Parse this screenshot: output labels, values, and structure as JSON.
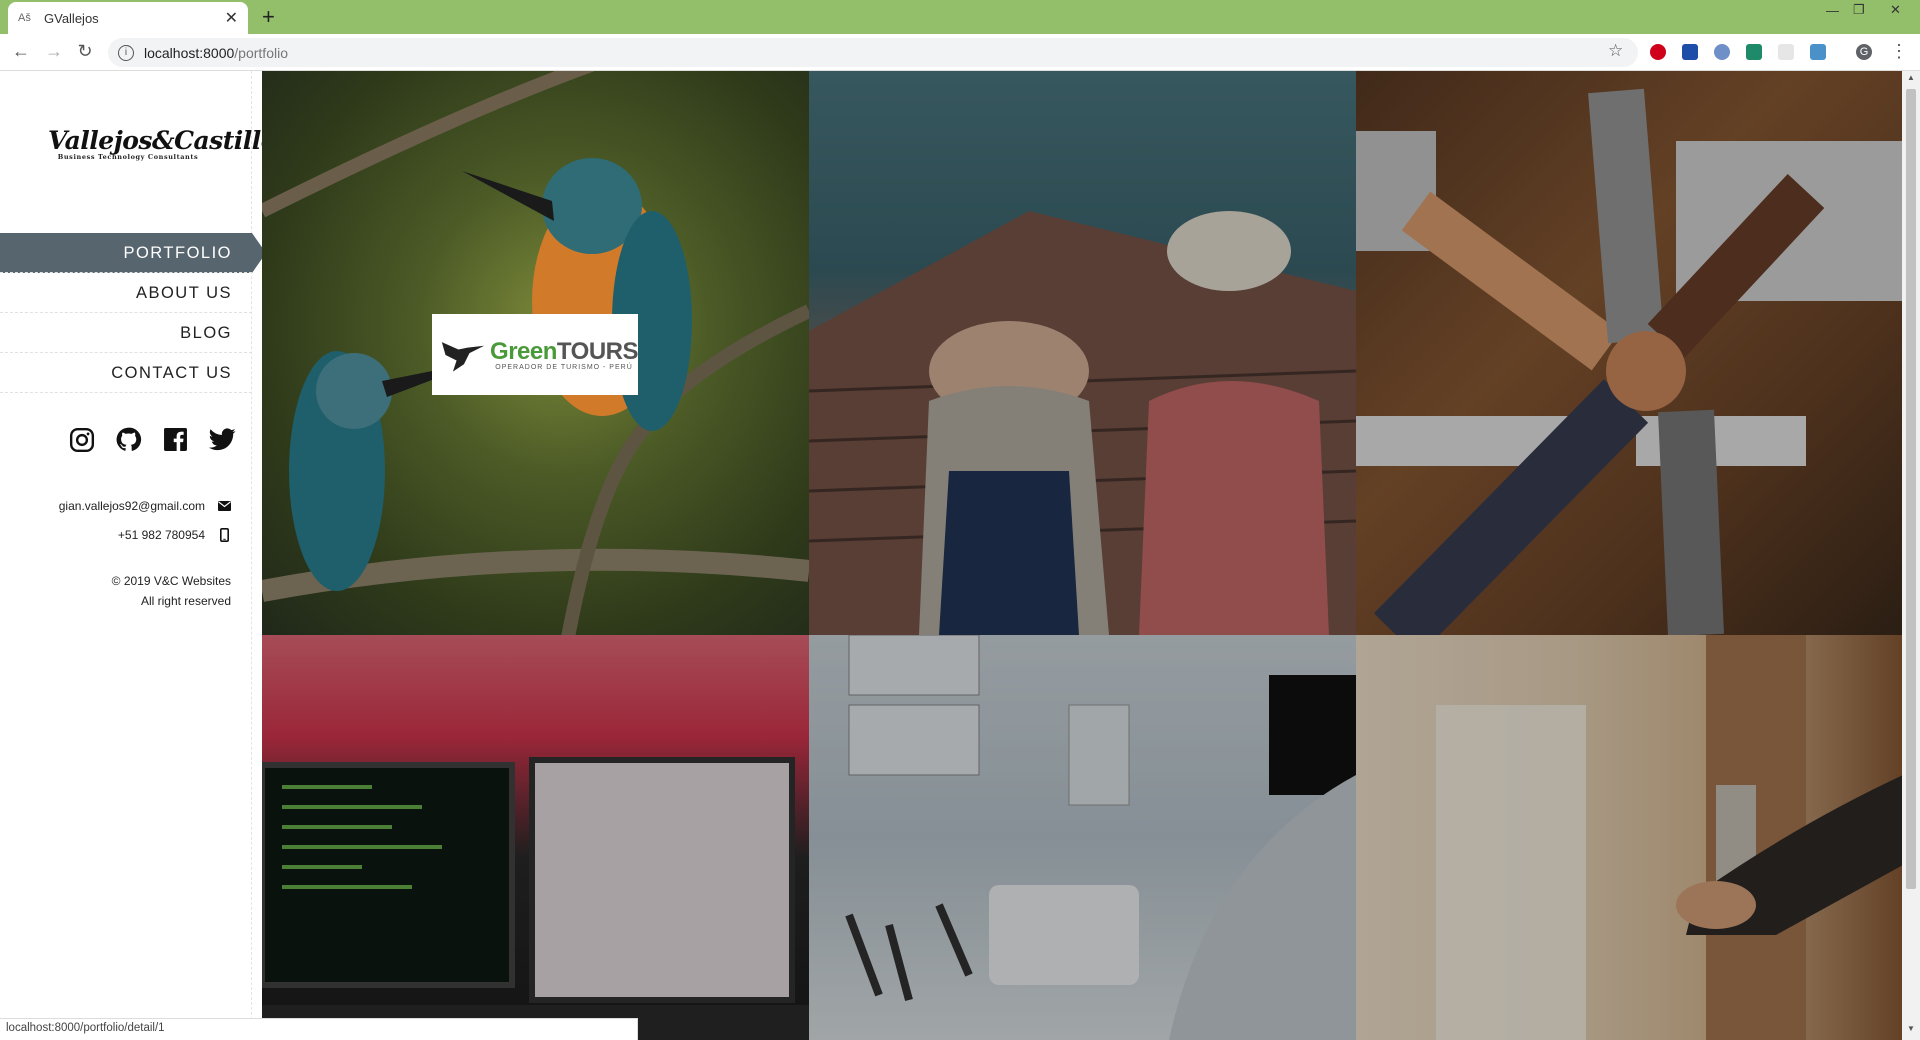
{
  "browser": {
    "tab_title": "GVallejos",
    "tab_favicon": "Aš",
    "url_host": "localhost:8000",
    "url_path": "/portfolio",
    "status_url": "localhost:8000/portfolio/detail/1",
    "chrome_color": "#93bf6b",
    "profile_letter": "G"
  },
  "sidebar": {
    "logo_script": "Vallejos&Castillo",
    "logo_tagline": "Business Technology Consultants",
    "nav": [
      {
        "label": "PORTFOLIO",
        "active": true
      },
      {
        "label": "ABOUT US",
        "active": false
      },
      {
        "label": "BLOG",
        "active": false
      },
      {
        "label": "CONTACT US",
        "active": false
      }
    ],
    "social": [
      "instagram-icon",
      "github-icon",
      "facebook-icon",
      "twitter-icon"
    ],
    "email": "gian.vallejos92@gmail.com",
    "phone": "+51 982 780954",
    "copyright": "© 2019 V&C Websites",
    "rights": "All right reserved",
    "accent": "#57656e"
  },
  "gallery": {
    "featured_badge": {
      "brand_green": "Green",
      "brand_dark": "TOURS",
      "subtitle": "OPERADOR DE TURISMO - PERÚ"
    },
    "tiles": [
      {
        "name": "kingfishers"
      },
      {
        "name": "construction-workers"
      },
      {
        "name": "team-fist-bump"
      },
      {
        "name": "code-monitors"
      },
      {
        "name": "dental-clinic"
      },
      {
        "name": "hotel-door"
      }
    ]
  }
}
